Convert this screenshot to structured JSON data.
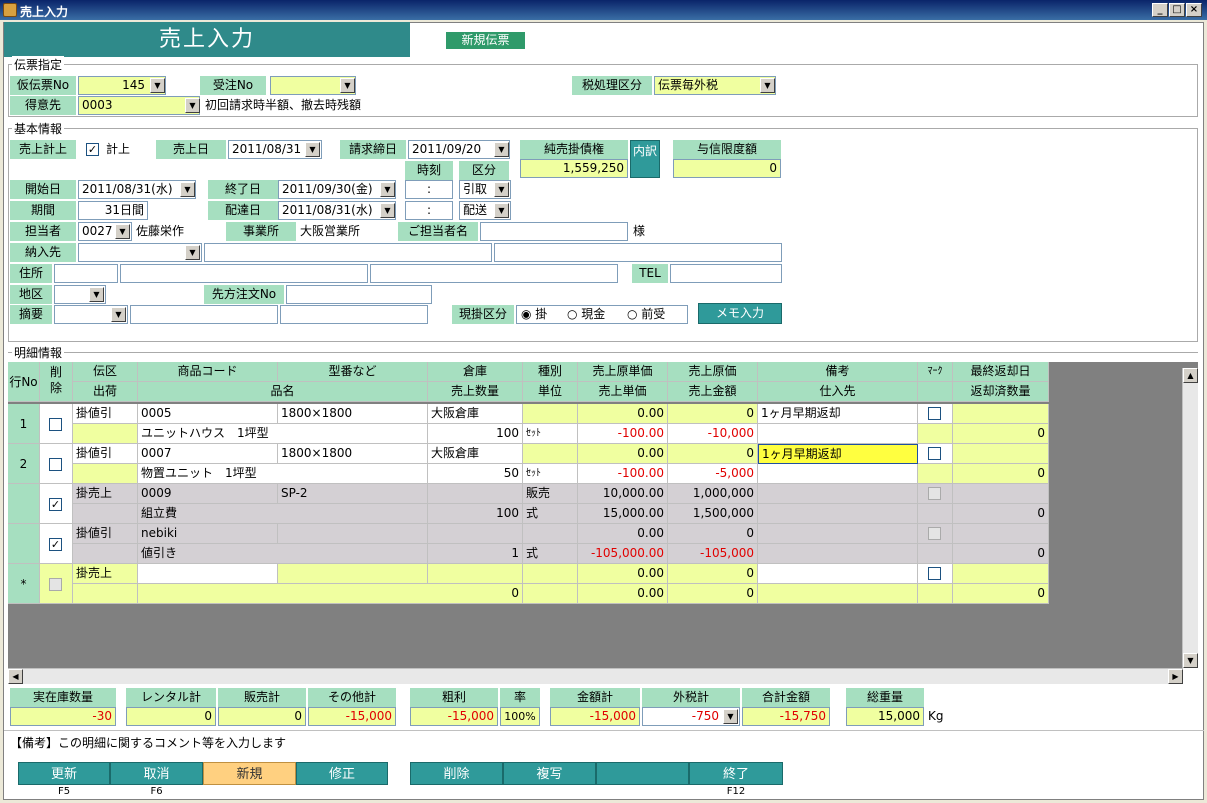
{
  "window": {
    "title": "売上入力"
  },
  "header": {
    "title": "売上入力",
    "new_slip": "新規伝票"
  },
  "slip": {
    "group_title": "伝票指定",
    "temp_no_label": "仮伝票No",
    "temp_no_value": "145",
    "order_no_label": "受注No",
    "order_no_value": "",
    "tax_label": "税処理区分",
    "tax_value": "伝票毎外税",
    "customer_label": "得意先",
    "customer_code": "0003",
    "customer_note": "初回請求時半額、撤去時残額"
  },
  "basic": {
    "group_title": "基本情報",
    "sales_post_label": "売上計上",
    "sales_post_check": "計上",
    "sales_date_label": "売上日",
    "sales_date": "2011/08/31",
    "billing_close_label": "請求締日",
    "billing_close": "2011/09/20",
    "net_ar_label": "純売掛債権",
    "net_ar_value": "1,559,250",
    "breakdown": "内訳",
    "credit_label": "与信限度額",
    "credit_value": "0",
    "time_label": "時刻",
    "kubun_label": "区分",
    "start_label": "開始日",
    "start_date": "2011/08/31(水)",
    "end_label": "終了日",
    "end_date": "2011/09/30(金)",
    "time1": ":",
    "kubun1": "引取",
    "period_label": "期間",
    "period_value": "31日間",
    "delivery_label": "配達日",
    "delivery_date": "2011/08/31(水)",
    "time2": ":",
    "kubun2": "配送",
    "staff_label": "担当者",
    "staff_code": "0027",
    "staff_name": "佐藤栄作",
    "office_label": "事業所",
    "office_value": "大阪営業所",
    "contact_label": "ご担当者名",
    "contact_suffix": "様",
    "ship_to_label": "納入先",
    "address_label": "住所",
    "tel_label": "TEL",
    "area_label": "地区",
    "customer_order_label": "先方注文No",
    "summary_label": "摘要",
    "payment_label": "現掛区分",
    "payment_options": [
      "掛",
      "現金",
      "前受"
    ],
    "memo_button": "メモ入力"
  },
  "detail": {
    "group_title": "明細情報",
    "headers_top": [
      "行No",
      "削除",
      "伝区",
      "商品コード",
      "型番など",
      "倉庫",
      "種別",
      "売上原単価",
      "売上原価",
      "備考",
      "ﾏｰｸ",
      "最終返却日"
    ],
    "headers_bottom": [
      "出荷",
      "品名",
      "売上数量",
      "単位",
      "売上単価",
      "売上金額",
      "仕入先",
      "返却済数量"
    ],
    "rows": [
      {
        "no": "1",
        "type": "掛値引",
        "code": "0005",
        "model": "1800×1800",
        "warehouse": "大阪倉庫",
        "kind": "",
        "unit_cost": "0.00",
        "cost": "0",
        "note": "1ヶ月早期返却",
        "name": "ユニットハウス　1坪型",
        "qty": "100",
        "unit": "ｾｯﾄ",
        "price": "-100.00",
        "amount": "-10,000",
        "returned": "0"
      },
      {
        "no": "2",
        "type": "掛値引",
        "code": "0007",
        "model": "1800×1800",
        "warehouse": "大阪倉庫",
        "kind": "",
        "unit_cost": "0.00",
        "cost": "0",
        "note": "1ヶ月早期返却",
        "name": "物置ユニット　1坪型",
        "qty": "50",
        "unit": "ｾｯﾄ",
        "price": "-100.00",
        "amount": "-5,000",
        "returned": "0"
      },
      {
        "no": "",
        "type": "掛売上",
        "code": "0009",
        "model": "SP-2",
        "warehouse": "",
        "kind": "販売",
        "unit_cost": "10,000.00",
        "cost": "1,000,000",
        "note": "",
        "name": "組立費",
        "qty": "100",
        "unit": "式",
        "price": "15,000.00",
        "amount": "1,500,000",
        "returned": "0"
      },
      {
        "no": "",
        "type": "掛値引",
        "code": "nebiki",
        "model": "",
        "warehouse": "",
        "kind": "",
        "unit_cost": "0.00",
        "cost": "0",
        "note": "",
        "name": "値引き",
        "qty": "1",
        "unit": "式",
        "price": "-105,000.00",
        "amount": "-105,000",
        "returned": "0"
      },
      {
        "no": "*",
        "type": "掛売上",
        "code": "",
        "model": "",
        "warehouse": "",
        "kind": "",
        "unit_cost": "0.00",
        "cost": "0",
        "note": "",
        "name": "",
        "qty": "0",
        "unit": "",
        "price": "0.00",
        "amount": "0",
        "returned": "0"
      }
    ]
  },
  "totals": {
    "stock_label": "実在庫数量",
    "stock_value": "-30",
    "rental_label": "レンタル計",
    "rental_value": "0",
    "sales_label": "販売計",
    "sales_value": "0",
    "other_label": "その他計",
    "other_value": "-15,000",
    "profit_label": "粗利",
    "profit_value": "-15,000",
    "rate_label": "率",
    "rate_value": "100%",
    "amount_label": "金額計",
    "amount_value": "-15,000",
    "tax_label": "外税計",
    "tax_value": "-750",
    "grand_label": "合計金額",
    "grand_value": "-15,750",
    "weight_label": "総重量",
    "weight_value": "15,000",
    "weight_unit": "Kg"
  },
  "status": {
    "message": "【備考】この明細に関するコメント等を入力します"
  },
  "fkeys": [
    {
      "label": "更新",
      "key": "F5"
    },
    {
      "label": "取消",
      "key": "F6"
    },
    {
      "label": "新規",
      "key": ""
    },
    {
      "label": "修正",
      "key": ""
    },
    {
      "label": "削除",
      "key": ""
    },
    {
      "label": "複写",
      "key": ""
    },
    {
      "label": "",
      "key": ""
    },
    {
      "label": "終了",
      "key": "F12"
    }
  ],
  "colors": {
    "accent": "#2f8a8a",
    "label_bg": "#a6dfc0",
    "input_yellow": "#f0ffa0",
    "negative": "#e00000",
    "active_fkey": "#ffd080"
  }
}
